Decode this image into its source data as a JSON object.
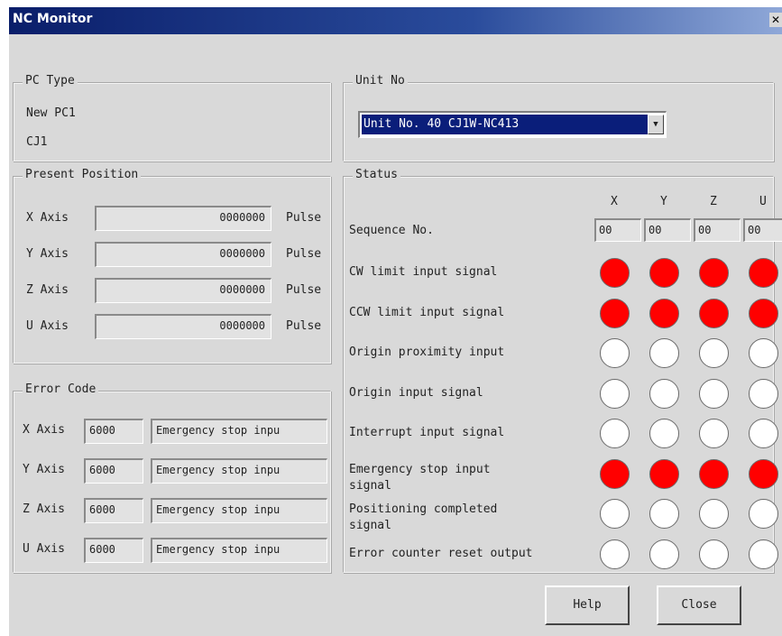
{
  "window": {
    "title": "NC Monitor",
    "close_glyph": "✕"
  },
  "pc_type": {
    "legend": "PC Type",
    "line1": "New PC1",
    "line2": "CJ1"
  },
  "unit_no": {
    "legend": "Unit No",
    "selected": "Unit No. 40 CJ1W-NC413",
    "arrow_glyph": "▼"
  },
  "present_position": {
    "legend": "Present Position",
    "rows": [
      {
        "axis": "X Axis",
        "value": "0000000",
        "unit": "Pulse"
      },
      {
        "axis": "Y Axis",
        "value": "0000000",
        "unit": "Pulse"
      },
      {
        "axis": "Z Axis",
        "value": "0000000",
        "unit": "Pulse"
      },
      {
        "axis": "U Axis",
        "value": "0000000",
        "unit": "Pulse"
      }
    ]
  },
  "error_code": {
    "legend": "Error Code",
    "rows": [
      {
        "axis": "X Axis",
        "code": "6000",
        "message": "Emergency stop inpu"
      },
      {
        "axis": "Y Axis",
        "code": "6000",
        "message": "Emergency stop inpu"
      },
      {
        "axis": "Z Axis",
        "code": "6000",
        "message": "Emergency stop inpu"
      },
      {
        "axis": "U Axis",
        "code": "6000",
        "message": "Emergency stop inpu"
      }
    ]
  },
  "status": {
    "legend": "Status",
    "axes": [
      "X",
      "Y",
      "Z",
      "U"
    ],
    "sequence": {
      "label": "Sequence No.",
      "values": [
        "00",
        "00",
        "00",
        "00"
      ]
    },
    "signals": [
      {
        "label": "CW limit input signal",
        "states": [
          true,
          true,
          true,
          true
        ]
      },
      {
        "label": "CCW limit input signal",
        "states": [
          true,
          true,
          true,
          true
        ]
      },
      {
        "label": "Origin proximity input",
        "states": [
          false,
          false,
          false,
          false
        ]
      },
      {
        "label": "Origin input signal",
        "states": [
          false,
          false,
          false,
          false
        ]
      },
      {
        "label": "Interrupt input signal",
        "states": [
          false,
          false,
          false,
          false
        ]
      },
      {
        "label": "Emergency stop input",
        "label2": "signal",
        "states": [
          true,
          true,
          true,
          true
        ]
      },
      {
        "label": "Positioning completed",
        "label2": "signal",
        "states": [
          false,
          false,
          false,
          false
        ]
      },
      {
        "label": "Error counter reset output",
        "states": [
          false,
          false,
          false,
          false
        ]
      }
    ],
    "colors": {
      "on": "#ff0000",
      "off": "#ffffff"
    }
  },
  "buttons": {
    "help": "Help",
    "close": "Close"
  }
}
